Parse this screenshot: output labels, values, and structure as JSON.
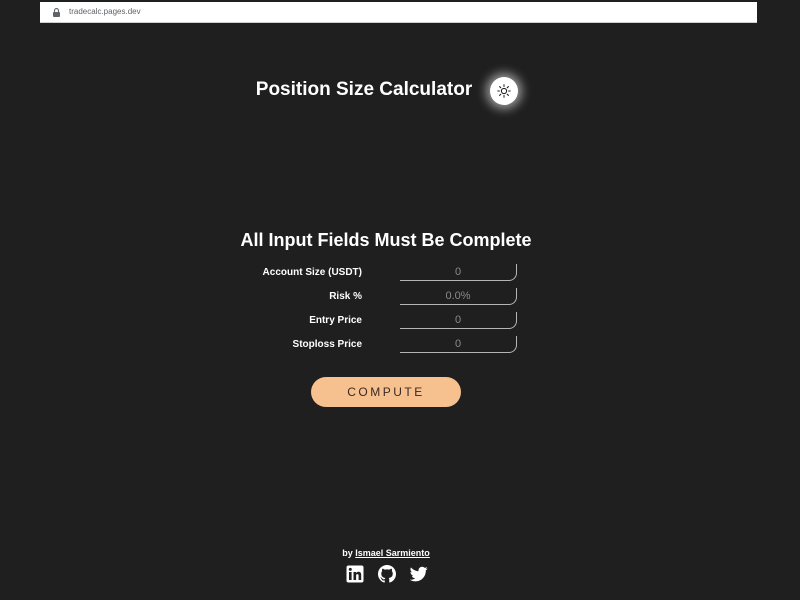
{
  "browser": {
    "url": "tradecalc.pages.dev"
  },
  "header": {
    "title": "Position Size Calculator",
    "theme_icon": "sun-icon"
  },
  "form": {
    "heading": "All Input Fields Must Be Complete",
    "fields": [
      {
        "label": "Account Size (USDT)",
        "placeholder": "0"
      },
      {
        "label": "Risk %",
        "placeholder": "0.0%"
      },
      {
        "label": "Entry Price",
        "placeholder": "0"
      },
      {
        "label": "Stoploss Price",
        "placeholder": "0"
      }
    ],
    "compute_label": "COMPUTE"
  },
  "footer": {
    "by_text": "by",
    "author": "Ismael Sarmiento",
    "social_icons": [
      "linkedin-icon",
      "github-icon",
      "twitter-icon"
    ]
  },
  "colors": {
    "background": "#1f1f1f",
    "button": "#f7c08f",
    "text": "#ffffff"
  }
}
